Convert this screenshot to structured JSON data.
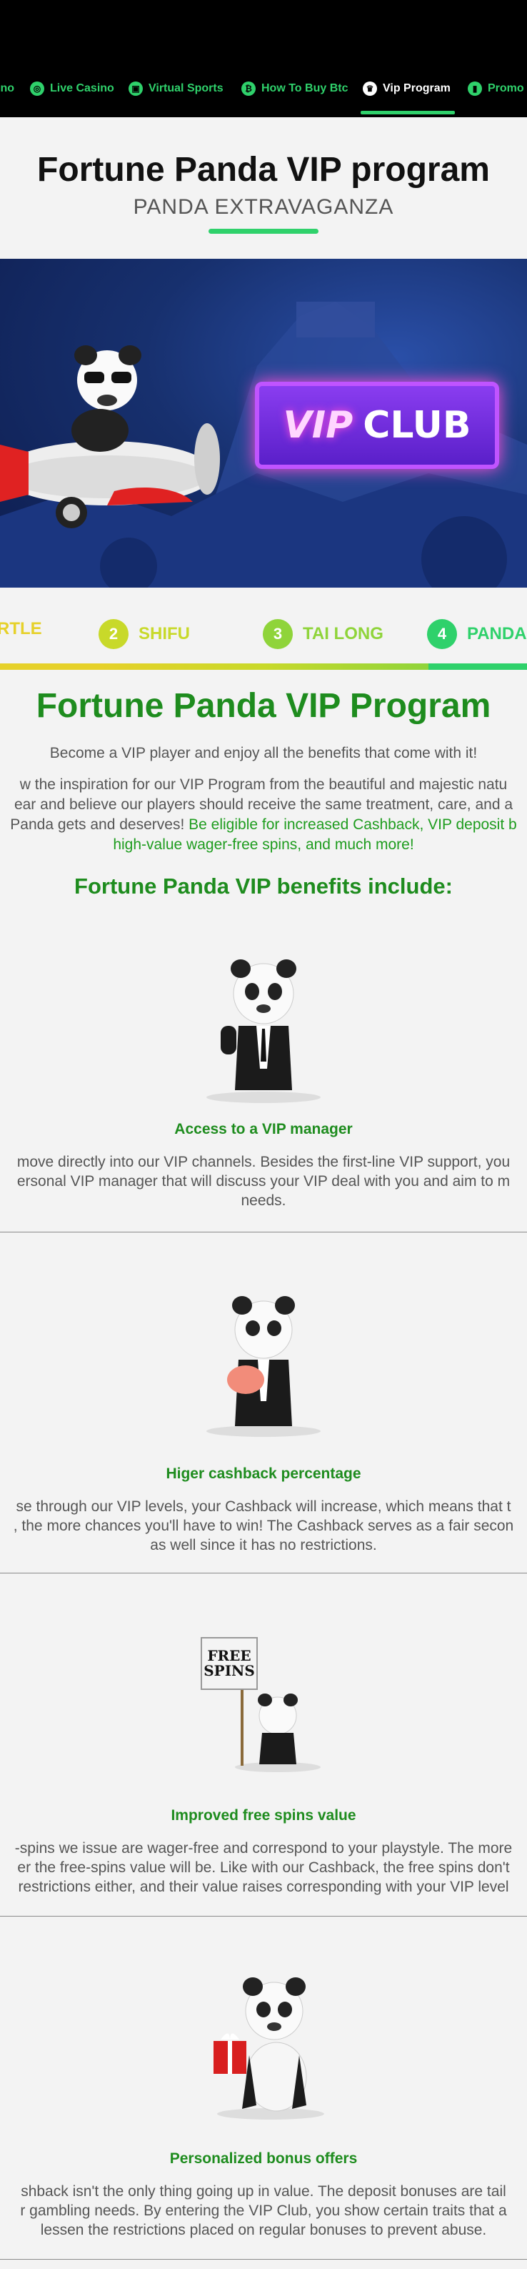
{
  "nav": {
    "items": [
      {
        "label": "ino",
        "icon": "casino-icon"
      },
      {
        "label": "Live Casino",
        "icon": "live-casino-icon"
      },
      {
        "label": "Virtual Sports",
        "icon": "virtual-sports-icon"
      },
      {
        "label": "How To Buy Btc",
        "icon": "bitcoin-icon"
      },
      {
        "label": "Vip Program",
        "icon": "crown-icon",
        "active": true
      },
      {
        "label": "Promo",
        "icon": "promo-icon"
      }
    ]
  },
  "hero": {
    "title": "Fortune Panda VIP program",
    "subtitle": "PANDA EXTRAVAGANZA"
  },
  "banner": {
    "sign_vip": "VIP",
    "sign_club": "CLUB"
  },
  "levels": [
    {
      "num": "",
      "label": "RTLE",
      "color": "#e6d12a"
    },
    {
      "num": "2",
      "label": "SHIFU",
      "color": "#c8d92a"
    },
    {
      "num": "3",
      "label": "TAI LONG",
      "color": "#8fd43a"
    },
    {
      "num": "4",
      "label": "PANDA",
      "color": "#2fd16b"
    }
  ],
  "program": {
    "title": "Fortune Panda VIP Program",
    "intro": "Become a VIP player and enjoy all the benefits that come with it!",
    "body_line1": "w the inspiration for our VIP Program from the beautiful and majestic natu",
    "body_line2": "ear and believe our players should receive the same treatment, care, and a",
    "body_line3_plain": "Panda gets and deserves! ",
    "body_line3_highlight": "Be eligible for increased Cashback, VIP deposit b",
    "body_line4_highlight": "high-value wager-free spins, and much more!",
    "benefits_title": "Fortune Panda VIP benefits include:"
  },
  "benefits": [
    {
      "title": "Access to a VIP manager",
      "lines": [
        "move directly into our VIP channels. Besides the first-line VIP support, you",
        "ersonal VIP manager that will discuss your VIP deal with you and aim to m",
        "needs."
      ]
    },
    {
      "title": "Higer cashback percentage",
      "lines": [
        "se through our VIP levels, your Cashback will increase, which means that t",
        ", the more chances you'll have to win! The Cashback serves as a fair secon",
        "as well since it has no restrictions."
      ]
    },
    {
      "title": "Improved free spins value",
      "sign": "FREE SPINS",
      "lines": [
        "-spins we issue are wager-free and correspond to your playstyle. The more",
        "er the free-spins value will be. Like with our Cashback, the free spins don't",
        "restrictions either, and their value raises corresponding with your VIP level"
      ]
    },
    {
      "title": "Personalized bonus offers",
      "lines": [
        "shback isn't the only thing going up in value. The deposit bonuses are tail",
        "r gambling needs. By entering the VIP Club, you show certain traits that a",
        "lessen the restrictions placed on regular bonuses to prevent abuse."
      ]
    }
  ]
}
